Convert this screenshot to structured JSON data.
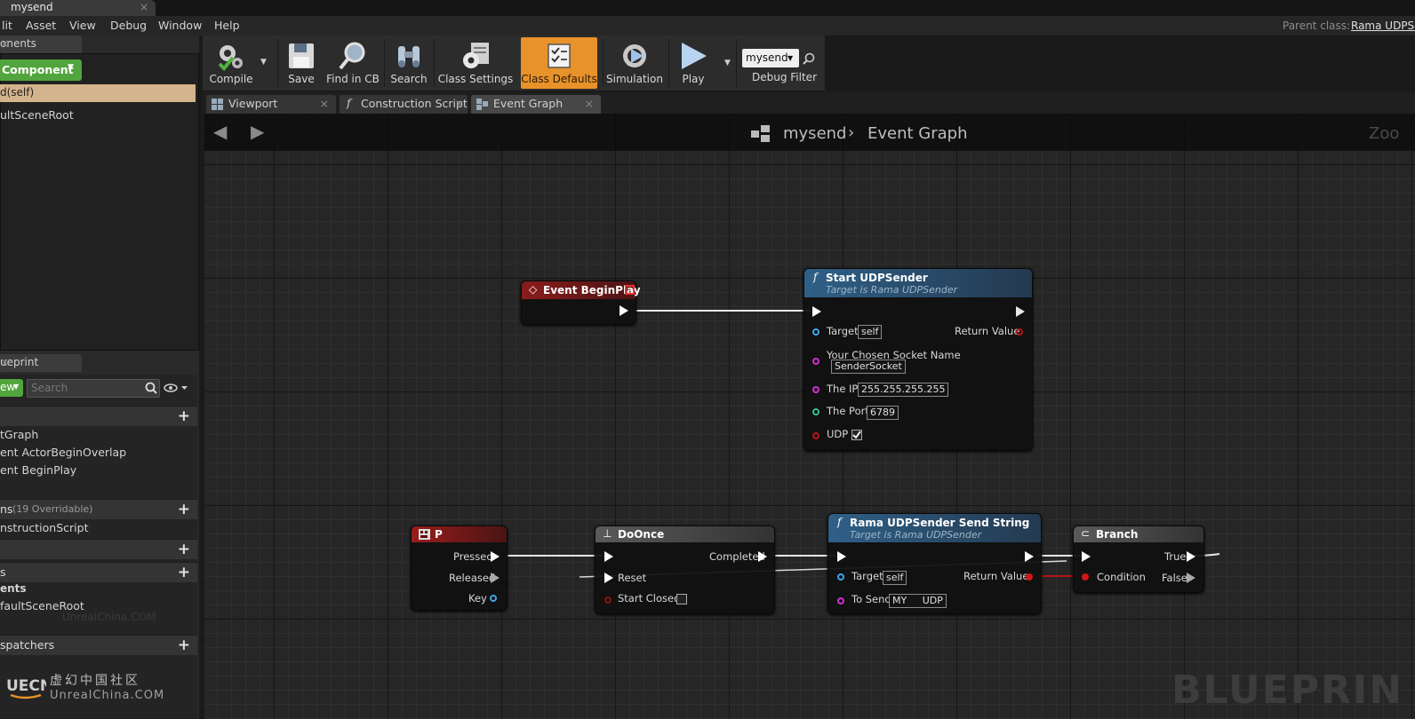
{
  "window": {
    "tab_title": "mysend",
    "close": "×"
  },
  "menu": [
    "lit",
    "Asset",
    "View",
    "Debug",
    "Window",
    "Help"
  ],
  "parent_class": {
    "label": "Parent class:",
    "value": "Rama UDPSe"
  },
  "components_panel": {
    "tab": "onents",
    "add_button": "Component",
    "self_row": "d(self)",
    "root_item": "ultSceneRoot"
  },
  "myblueprint_panel": {
    "tab": "ueprint",
    "add_new": "ew",
    "search_placeholder": "Search",
    "graphs": [
      "tGraph",
      "ent ActorBeginOverlap",
      "ent BeginPlay"
    ],
    "functions_header": "ns",
    "functions_overridable": "(19 Overridable)",
    "functions": [
      "nstructionScript"
    ],
    "variables_header": "s",
    "variables_subheader": "ents",
    "variables": [
      "faultSceneRoot"
    ],
    "dispatchers_header": "spatchers",
    "watermark": "UnrealChina.COM"
  },
  "toolbar": {
    "compile": "Compile",
    "save": "Save",
    "find_in_cb": "Find in CB",
    "search": "Search",
    "class_settings": "Class Settings",
    "class_defaults": "Class Defaults",
    "simulation": "Simulation",
    "play": "Play",
    "debug_object": "mysend",
    "debug_filter": "Debug Filter"
  },
  "editor_tabs": [
    {
      "label": "Viewport"
    },
    {
      "label": "Construction Script"
    },
    {
      "label": "Event Graph"
    }
  ],
  "breadcrumb": {
    "blueprint": "mysend",
    "graph": "Event Graph",
    "zoom": "Zoo"
  },
  "graph_watermark": "BLUEPRIN",
  "nodes": {
    "begin_play": {
      "title": "Event BeginPlay"
    },
    "start_udp": {
      "title": "Start UDPSender",
      "subtitle": "Target is Rama UDPSender",
      "target": "Target",
      "target_val": "self",
      "return_value": "Return Value",
      "socket_name": "Your Chosen Socket Name",
      "socket_val": "SenderSocket",
      "ip": "The IP",
      "ip_val": "255.255.255.255",
      "port": "The Port",
      "port_val": "6789",
      "udp": "UDP",
      "udp_checked": true
    },
    "key_p": {
      "title": "P",
      "pressed": "Pressed",
      "released": "Released",
      "key": "Key"
    },
    "do_once": {
      "title": "DoOnce",
      "completed": "Completed",
      "reset": "Reset",
      "start_closed": "Start Closed"
    },
    "send_string": {
      "title": "Rama UDPSender Send String",
      "subtitle": "Target is Rama UDPSender",
      "target": "Target",
      "target_val": "self",
      "return_value": "Return Value",
      "to_send": "To Send",
      "to_send_val": "MY     UDP"
    },
    "branch": {
      "title": "Branch",
      "true": "True",
      "false": "False",
      "condition": "Condition"
    }
  },
  "logo": {
    "cn": "虚幻中国社区",
    "en": "UnrealChina.COM",
    "mark": "UECN"
  },
  "colors": {
    "accent": "#e8922a",
    "green": "#52a53c",
    "event_red": "#8a1c1c",
    "func_blue": "#2f5f87"
  }
}
